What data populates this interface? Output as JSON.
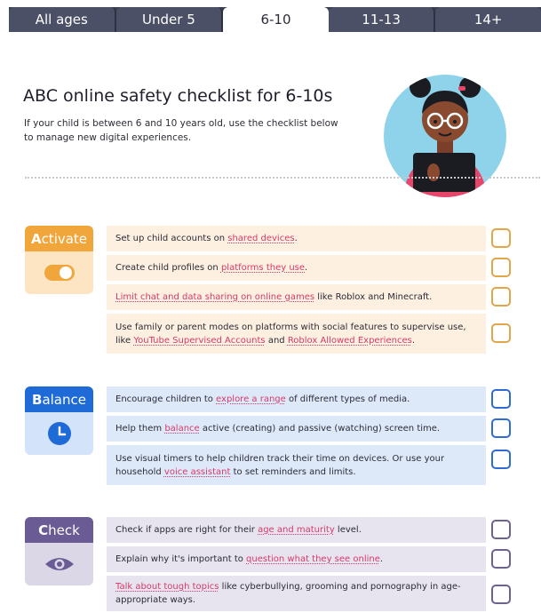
{
  "tabs": [
    {
      "label": "All ages",
      "active": false
    },
    {
      "label": "Under 5",
      "active": false
    },
    {
      "label": "6-10",
      "active": true
    },
    {
      "label": "11-13",
      "active": false
    },
    {
      "label": "14+",
      "active": false
    }
  ],
  "header": {
    "title": "ABC online safety checklist for 6-10s",
    "subtitle": "If your child is between 6 and 10 years old, use the checklist below to manage new digital experiences."
  },
  "colors": {
    "activate": "#f0a63b",
    "balance": "#1e6ad6",
    "check": "#6a5b95",
    "link": "#d63a6a"
  },
  "sections": {
    "activate": {
      "label_first": "A",
      "label_rest": "ctivate",
      "icon": "toggle-on-icon",
      "items": [
        {
          "pre": "Set up child accounts on ",
          "link": "shared devices",
          "post": "."
        },
        {
          "pre": "Create child profiles on ",
          "link": "platforms they use",
          "post": "."
        },
        {
          "pre": "",
          "link": "Limit chat and data sharing on online games",
          "post": " like Roblox and Minecraft."
        },
        {
          "pre": "Use family or parent modes on platforms with social features to supervise use, like ",
          "link": "YouTube Supervised Accounts",
          "mid": " and ",
          "link2": "Roblox Allowed Experiences",
          "post": "."
        }
      ]
    },
    "balance": {
      "label_first": "B",
      "label_rest": "alance",
      "icon": "clock-icon",
      "items": [
        {
          "pre": "Encourage children to ",
          "link": "explore a range",
          "post": " of different types of media."
        },
        {
          "pre": "Help them ",
          "link": "balance",
          "post": " active (creating) and passive (watching) screen time."
        },
        {
          "pre": "Use visual timers to help children track their time on devices. Or use your household ",
          "link": "voice assistant",
          "post": " to set reminders and limits."
        }
      ]
    },
    "check": {
      "label_first": "C",
      "label_rest": "heck",
      "icon": "eye-icon",
      "items": [
        {
          "pre": "Check if apps are right for their ",
          "link": "age and maturity",
          "post": " level."
        },
        {
          "pre": "Explain why it's important to ",
          "link": "question what they see online",
          "post": "."
        },
        {
          "pre": "",
          "link": "Talk about tough topics",
          "post": " like cyberbullying, grooming and pornography in age-appropriate ways."
        }
      ]
    }
  }
}
